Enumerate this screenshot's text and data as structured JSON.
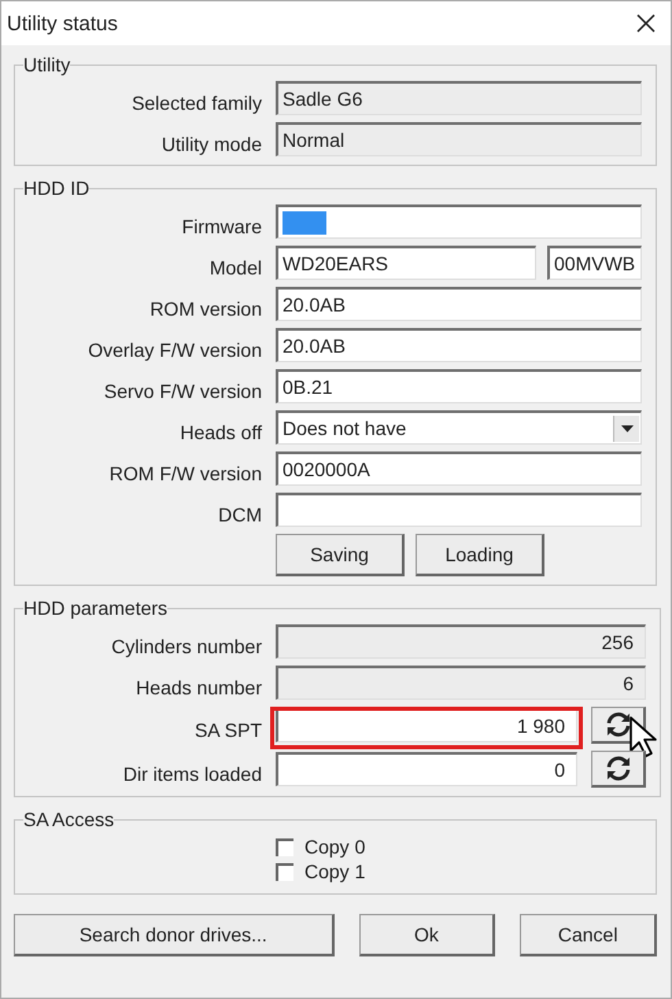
{
  "window": {
    "title": "Utility status"
  },
  "groups": [
    {
      "title": "Utility",
      "rows": [
        {
          "label": "Selected family",
          "kind": "readonly",
          "value": "Sadle G6"
        },
        {
          "label": "Utility mode",
          "kind": "readonly",
          "value": "Normal"
        }
      ]
    },
    {
      "title": "HDD ID",
      "rows": [
        {
          "label": "Firmware",
          "kind": "text",
          "selection": true
        },
        {
          "label": "Model",
          "kind": "split",
          "value": "WD20EARS",
          "value_2": "00MVWB"
        },
        {
          "label": "ROM version",
          "kind": "text",
          "value": "20.0AB"
        },
        {
          "label": "Overlay F/W version",
          "kind": "text",
          "value": "20.0AB"
        },
        {
          "label": "Servo F/W version",
          "kind": "text",
          "value": "0B.21"
        },
        {
          "label": "Heads off",
          "kind": "combo",
          "value": "Does not have"
        },
        {
          "label": "ROM F/W version",
          "kind": "text",
          "value": "0020000A"
        },
        {
          "label": "DCM",
          "kind": "text"
        }
      ],
      "buttons": [
        "Saving",
        "Loading"
      ]
    },
    {
      "title": "HDD parameters",
      "rows": [
        {
          "label": "Cylinders number",
          "kind": "readonly_number",
          "value": "256",
          "annotated": false
        },
        {
          "label": "Heads number",
          "kind": "readonly_number",
          "value": "6",
          "annotated": false
        },
        {
          "label": "SA SPT",
          "kind": "number_refresh",
          "value": "1 980",
          "annotated": true
        },
        {
          "label": "Dir items loaded",
          "kind": "number_refresh",
          "value": "0",
          "annotated": false
        }
      ]
    },
    {
      "title": "SA Access",
      "checkboxes": [
        {
          "label": "Copy 0",
          "checked": false
        },
        {
          "label": "Copy 1",
          "checked": false
        }
      ]
    }
  ],
  "footer_buttons": [
    {
      "label": "Search donor drives...",
      "kind": "wide"
    },
    {
      "label": "Ok",
      "kind": "normal"
    },
    {
      "label": "Cancel",
      "kind": "normal"
    }
  ]
}
